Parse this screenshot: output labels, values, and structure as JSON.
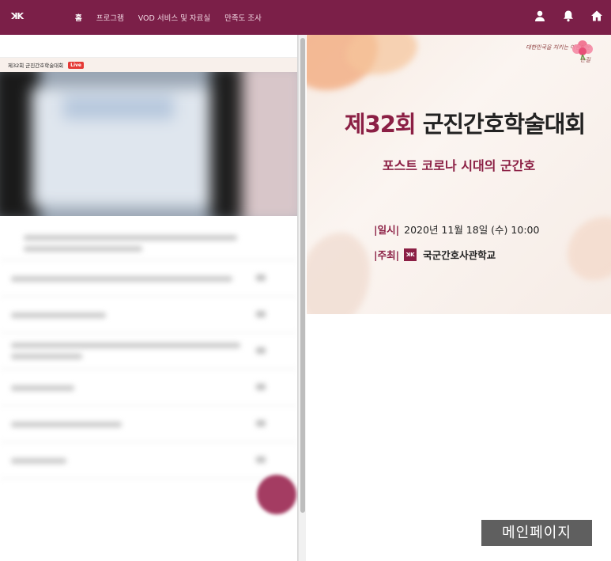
{
  "topbar": {
    "nav": [
      "홈",
      "프로그램",
      "VOD 서비스 및 자료실",
      "만족도 조사"
    ],
    "icons": [
      "user-icon",
      "bell-icon",
      "home-icon"
    ],
    "color": "#7b1f48"
  },
  "live": {
    "title": "제32회 군진간호학술대회",
    "badge": "Live"
  },
  "poster": {
    "slogan": "대한민국을 지키는 아름다운 손길",
    "title_num": "제32회",
    "title_rest": "군진간호학술대회",
    "subtitle": "포스트 코로나 시대의 군간호",
    "date_label": "|일시|",
    "date_value": "2020년 11월 18일 (수) 10:00",
    "host_label": "|주최|",
    "host_value": "국군간호사관학교"
  },
  "overlay_label": "메인페이지",
  "colors": {
    "accent": "#8b1f44",
    "live_badge": "#e53935"
  }
}
